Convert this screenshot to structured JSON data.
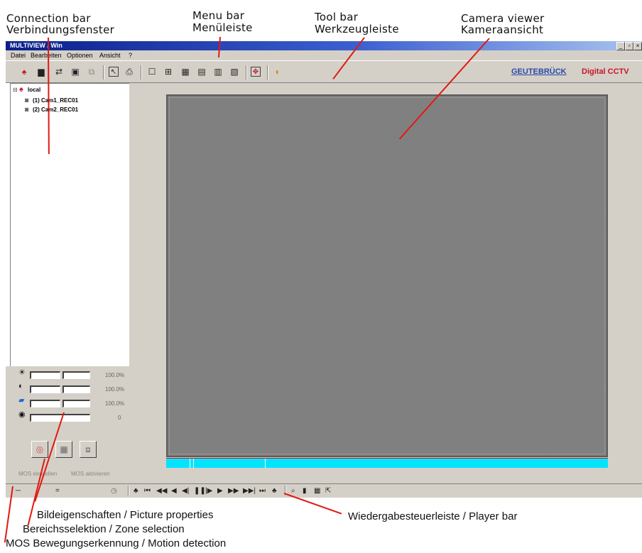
{
  "annotations": {
    "connection_bar": "Connection bar",
    "verbindungsfenster": "Verbindungsfenster",
    "menu_bar": "Menu bar",
    "menuleiste": "Menüleiste",
    "tool_bar": "Tool bar",
    "werkzeugleiste": "Werkzeugleiste",
    "camera_viewer": "Camera viewer",
    "kameraansicht": "Kameraansicht",
    "picture_properties": "Bildeigenschaften / Picture properties",
    "player_bar": "Wiedergabesteuerleiste / Player bar",
    "zone_selection": "Bereichsselektion / Zone selection",
    "motion_detection": "MOS Bewegungserkennung / Motion detection"
  },
  "window": {
    "title": "MULTIVIEW / Win",
    "controls": [
      "_",
      "▫",
      "×"
    ]
  },
  "menu": {
    "items": [
      "Datei",
      "Bearbeiten",
      "Optionen",
      "Ansicht",
      "?"
    ]
  },
  "toolbar": {
    "brand": "GEUTEBRÜCK",
    "brand_suffix": "Digital CCTV"
  },
  "connection_tree": {
    "root": "local",
    "cameras": [
      "(1) Cam1_REC01",
      "(2) Cam2_REC01"
    ]
  },
  "picture_properties": {
    "brightness_value": "100.0%",
    "contrast_value": "100.0%",
    "color_value": "100.0%",
    "sharpness_value": "0"
  },
  "mos": {
    "settings_label": "MOS einstellen",
    "activate_label": "MOS aktivieren"
  },
  "colors": {
    "title_gradient_start": "#0a1f8a",
    "panel_bg": "#d4d0c8",
    "viewer_bg": "#808080",
    "timeline": "#00e4ff",
    "callout_line": "#e01a10",
    "brand_blue": "#2a4aa8",
    "brand_red": "#c81428"
  }
}
